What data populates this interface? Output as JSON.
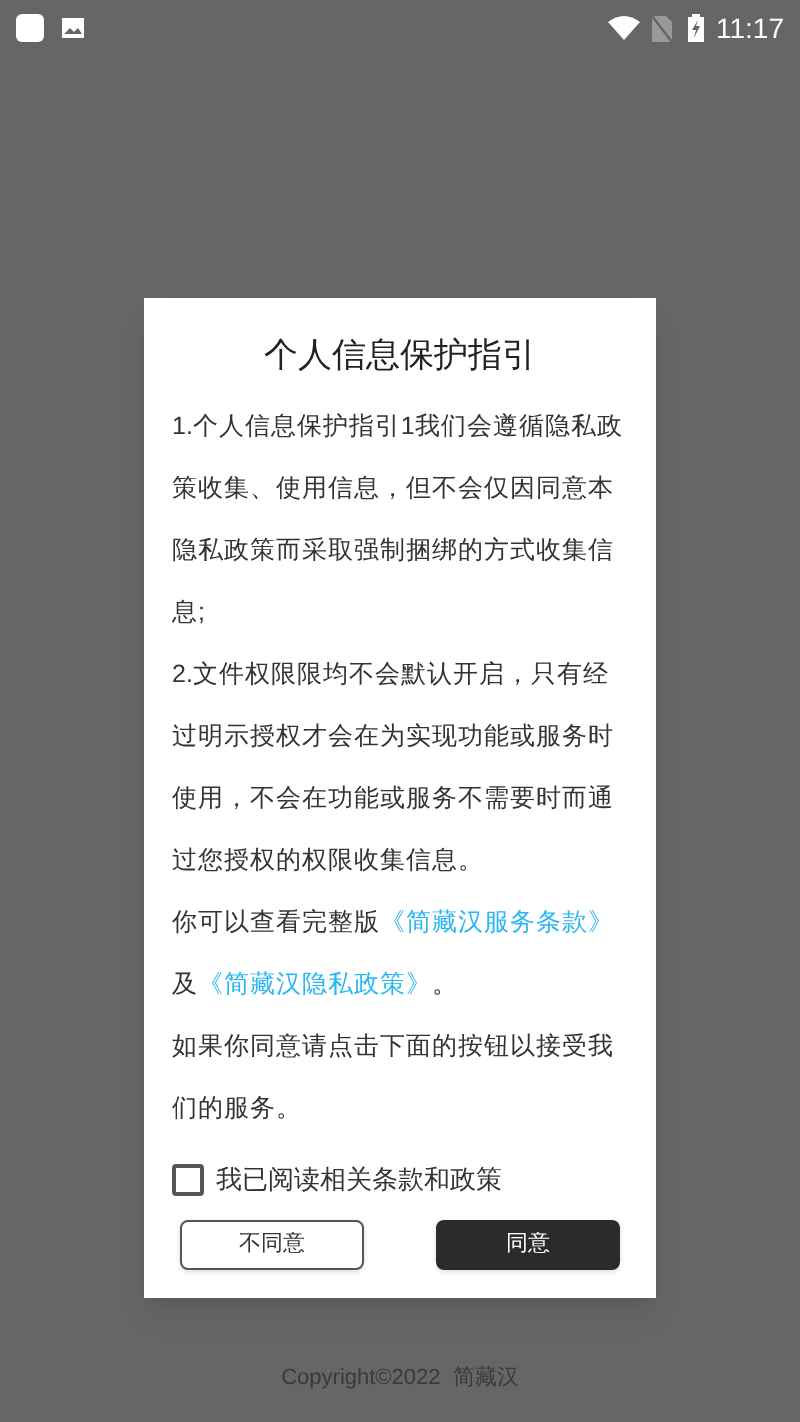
{
  "status_bar": {
    "time": "11:17"
  },
  "dialog": {
    "title": "个人信息保护指引",
    "paragraphs": [
      "1.个人信息保护指引1我们会遵循隐私政策收集、使用信息，但不会仅因同意本隐私政策而采取强制捆绑的方式收集信息;",
      "2.文件权限限均不会默认开启，只有经过明示授权才会在为实现功能或服务时使用，不会在功能或服务不需要时而通过您授权的权限收集信息。"
    ],
    "links_sentence": {
      "before": "你可以查看完整版",
      "link_1": "《简藏汉服务条款》",
      "middle": "及",
      "link_2": "《简藏汉隐私政策》",
      "after": "。"
    },
    "closing": "如果你同意请点击下面的按钮以接受我们的服务。",
    "agreement": {
      "label": "我已阅读相关条款和政策",
      "checked": false
    },
    "buttons": [
      {
        "label": "不同意",
        "kind": "secondary"
      },
      {
        "label": "同意",
        "kind": "primary"
      }
    ]
  },
  "footer": "Copyright©2022  简藏汉"
}
